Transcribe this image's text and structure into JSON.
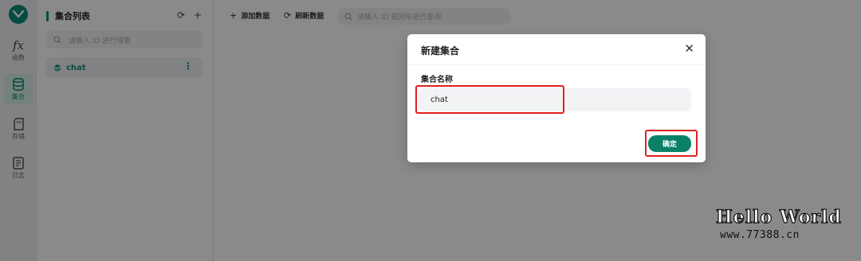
{
  "rail": {
    "items": [
      {
        "label": "函数",
        "icon": "function-icon"
      },
      {
        "label": "集合",
        "icon": "database-icon"
      },
      {
        "label": "存储",
        "icon": "storage-icon"
      },
      {
        "label": "日志",
        "icon": "log-icon"
      }
    ]
  },
  "sidebar": {
    "title": "集合列表",
    "search_placeholder": "请输入 ID 进行搜索",
    "collections": [
      {
        "name": "chat"
      }
    ]
  },
  "toolbar": {
    "add_label": "添加数据",
    "refresh_label": "刷新数据",
    "search_placeholder": "请输入 ID 按回车进行查询"
  },
  "modal": {
    "title": "新建集合",
    "field_label": "集合名称",
    "field_value": "chat",
    "confirm_label": "确定"
  },
  "watermark": {
    "line1": "Hello World",
    "line2": "www.77388.cn"
  },
  "colors": {
    "accent": "#0a8f77",
    "highlight": "#e02020"
  }
}
